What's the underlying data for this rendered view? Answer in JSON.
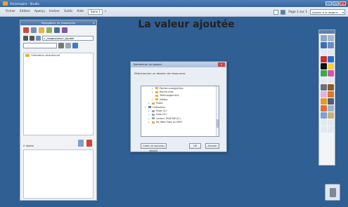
{
  "window": {
    "title": "ActivInspire - Studio"
  },
  "menu": {
    "items": [
      "Fichier",
      "Edition",
      "Aperçu",
      "Insérer",
      "Outils",
      "Aide"
    ],
    "tab_label": "Sans t",
    "tab_close": "×",
    "page_count": "Page 1 sur 1",
    "page_select": "Ajuster à la largeur"
  },
  "panel": {
    "title": "Navigateur de ressources",
    "path": "c:_images/valeur_ajoutée",
    "tree_item": "Ordinateur sélectionné",
    "lower_label": "0 objets"
  },
  "page": {
    "title": "La valeur ajoutée"
  },
  "dialog": {
    "title": "Rechercher un dossier",
    "prompt": "Sélectionnez un dossier de ressources",
    "close": "×",
    "tree": [
      {
        "label": "Parties enregistrées",
        "indent": 3,
        "icon": "folder",
        "expander": "▸"
      },
      {
        "label": "Recherches",
        "indent": 3,
        "icon": "folder",
        "expander": "▸"
      },
      {
        "label": "Téléchargement",
        "indent": 3,
        "icon": "folder",
        "expander": ""
      },
      {
        "label": "Vidéos",
        "indent": 3,
        "icon": "folder",
        "expander": "▸"
      },
      {
        "label": "Public",
        "indent": 2,
        "icon": "folder",
        "expander": "▸"
      },
      {
        "label": "Ordinateur",
        "indent": 1,
        "icon": "pc",
        "expander": "▾"
      },
      {
        "label": "Vista (C:)",
        "indent": 2,
        "icon": "drive",
        "expander": "▸"
      },
      {
        "label": "Data (D:)",
        "indent": 2,
        "icon": "drive",
        "expander": "▸"
      },
      {
        "label": "Lecteur DVD RW (E:)",
        "indent": 2,
        "icon": "drive",
        "expander": "▸"
      },
      {
        "label": "My Web Sites on MSN",
        "indent": 2,
        "icon": "folder",
        "expander": "▸"
      }
    ],
    "new_folder_button": "Créer un nouveau dossier",
    "ok_button": "OK",
    "cancel_button": "Annuler"
  },
  "colors": {
    "desktop": "#2f5f93",
    "accent": "#4f7fb6",
    "close_red": "#c9463d",
    "folder": "#dfb24c"
  }
}
